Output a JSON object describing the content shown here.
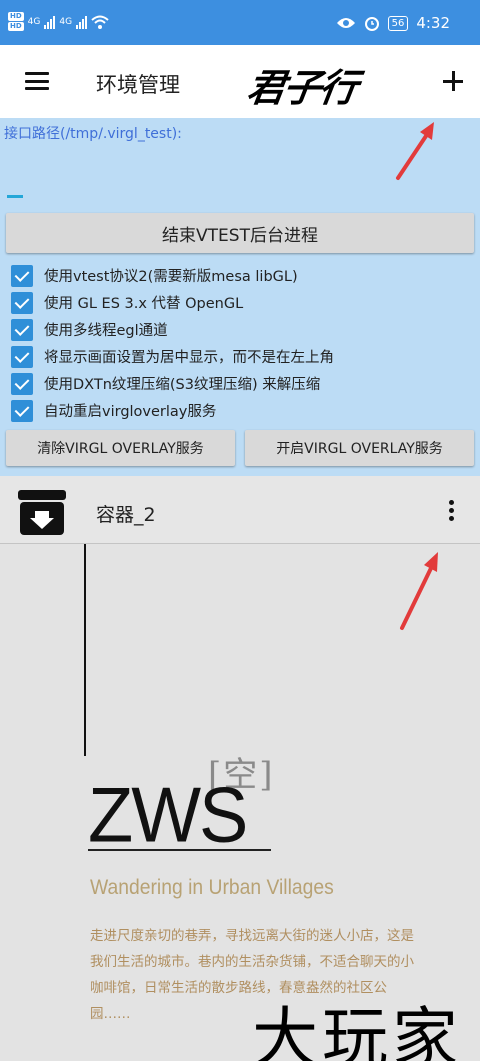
{
  "status_bar": {
    "hd1": "HD",
    "hd2": "HD",
    "net1": "4G",
    "net2": "4G",
    "battery": "56",
    "time": "4:32"
  },
  "app_bar": {
    "title": "环境管理",
    "brand": "君子行"
  },
  "panel": {
    "path_label": "接口路径(/tmp/.virgl_test):",
    "path_value": "",
    "stop_button": "结束VTEST后台进程",
    "options": [
      {
        "label": "使用vtest协议2(需要新版mesa libGL)",
        "checked": true
      },
      {
        "label": "使用 GL ES 3.x 代替 OpenGL",
        "checked": true
      },
      {
        "label": "使用多线程egl通道",
        "checked": true
      },
      {
        "label": "将显示画面设置为居中显示，而不是在左上角",
        "checked": true
      },
      {
        "label": "使用DXTn纹理压缩(S3纹理压缩) 来解压缩",
        "checked": true
      },
      {
        "label": "自动重启virgloverlay服务",
        "checked": true
      }
    ],
    "clear_button": "清除VIRGL OVERLAY服务",
    "start_button": "开启VIRGL OVERLAY服务"
  },
  "container": {
    "name": "容器_2"
  },
  "artwork": {
    "kong": "[空]",
    "zws": "ZWS",
    "subtitle": "Wandering in Urban Villages",
    "desc": "走进尺度亲切的巷弄，寻找远离大街的迷人小店，这是我们生活的城市。巷内的生活杂货铺，不适合聊天的小咖啡馆，日常生活的散步路线，春意盎然的社区公园……",
    "watermark": "大玩家"
  },
  "colors": {
    "status_bar": "#3d8fe0",
    "panel": "#bcdcf5",
    "checkbox": "#2f8fd8",
    "arrow": "#e23b3b"
  }
}
